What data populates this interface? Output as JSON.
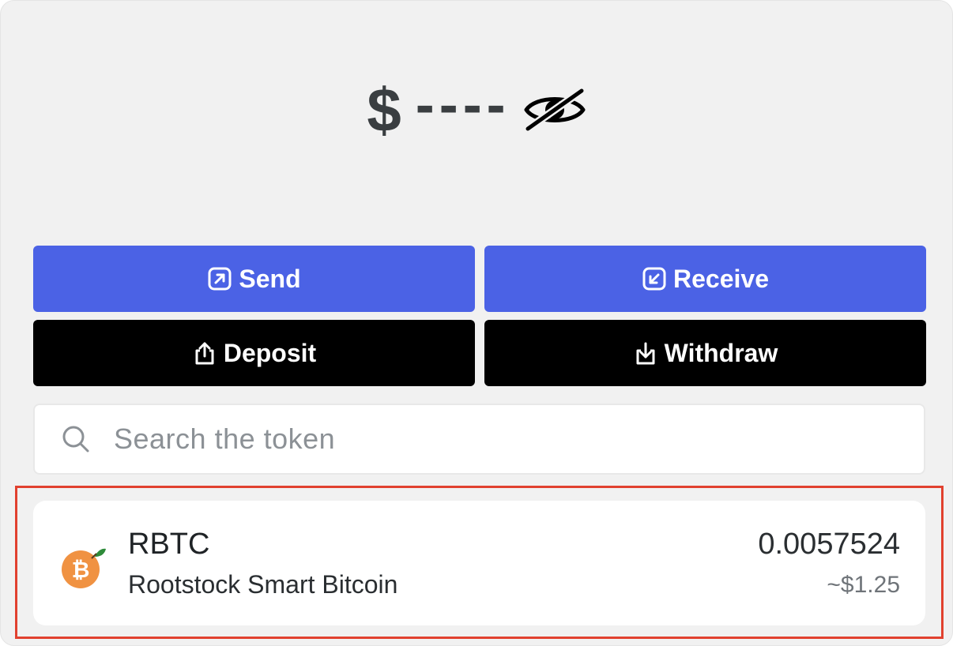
{
  "balance": {
    "currency_symbol": "$",
    "amount_masked": "----",
    "visibility_icon": "eye-slash-icon"
  },
  "actions": {
    "send_label": "Send",
    "receive_label": "Receive",
    "deposit_label": "Deposit",
    "withdraw_label": "Withdraw",
    "send_icon": "arrow-up-right-box-icon",
    "receive_icon": "arrow-down-left-box-icon",
    "deposit_icon": "upload-icon",
    "withdraw_icon": "download-icon"
  },
  "search": {
    "placeholder": "Search the token",
    "value": "",
    "icon": "search-icon"
  },
  "tokens": [
    {
      "symbol": "RBTC",
      "name": "Rootstock Smart Bitcoin",
      "balance": "0.0057524",
      "fiat_value": "~$1.25",
      "icon": "bitcoin-orange-icon"
    }
  ],
  "colors": {
    "primary_blue": "#4b62e5",
    "black": "#000000",
    "highlight_red": "#e1412f",
    "panel_bg": "#f1f1f1",
    "bitcoin_orange": "#f09242"
  }
}
